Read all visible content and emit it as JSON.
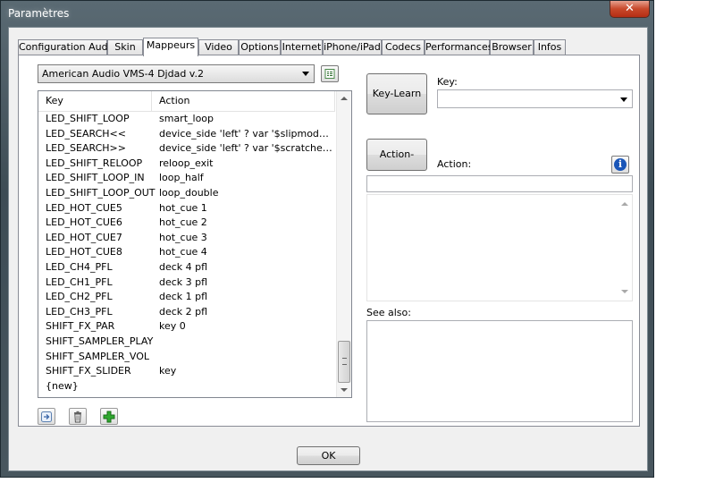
{
  "window": {
    "title": "Paramètres",
    "close_label": "✕"
  },
  "tabs": [
    {
      "label": "Configuration Audio"
    },
    {
      "label": "Skin"
    },
    {
      "label": "Mappeurs"
    },
    {
      "label": "Video"
    },
    {
      "label": "Options"
    },
    {
      "label": "Internet"
    },
    {
      "label": "iPhone/iPad"
    },
    {
      "label": "Codecs"
    },
    {
      "label": "Performances"
    },
    {
      "label": "Browser"
    },
    {
      "label": "Infos"
    }
  ],
  "mapper": {
    "selected": "American Audio VMS-4 Djdad v.2"
  },
  "table": {
    "columns": [
      "Key",
      "Action"
    ],
    "rows": [
      {
        "key": "LED_SHIFT_LOOP",
        "action": "smart_loop"
      },
      {
        "key": "LED_SEARCH<<",
        "action": "device_side 'left' ?  var '$slipmodel' ? bli..."
      },
      {
        "key": "LED_SEARCH>>",
        "action": "device_side 'left' ?  var '$scratcheffect'..."
      },
      {
        "key": "LED_SHIFT_RELOOP",
        "action": "reloop_exit"
      },
      {
        "key": "LED_SHIFT_LOOP_IN",
        "action": "loop_half"
      },
      {
        "key": "LED_SHIFT_LOOP_OUT",
        "action": "loop_double"
      },
      {
        "key": "LED_HOT_CUE5",
        "action": "hot_cue 1"
      },
      {
        "key": "LED_HOT_CUE6",
        "action": "hot_cue 2"
      },
      {
        "key": "LED_HOT_CUE7",
        "action": "hot_cue 3"
      },
      {
        "key": "LED_HOT_CUE8",
        "action": "hot_cue 4"
      },
      {
        "key": "LED_CH4_PFL",
        "action": "deck 4 pfl"
      },
      {
        "key": "LED_CH1_PFL",
        "action": "deck 3 pfl"
      },
      {
        "key": "LED_CH2_PFL",
        "action": "deck 1 pfl"
      },
      {
        "key": "LED_CH3_PFL",
        "action": "deck 2 pfl"
      },
      {
        "key": "SHIFT_FX_PAR",
        "action": "key 0"
      },
      {
        "key": "SHIFT_SAMPLER_PLAY",
        "action": ""
      },
      {
        "key": "SHIFT_SAMPLER_VOL",
        "action": ""
      },
      {
        "key": "SHIFT_FX_SLIDER",
        "action": "key"
      },
      {
        "key": "{new}",
        "action": ""
      }
    ]
  },
  "right": {
    "key_learn": "Key-Learn",
    "key_label": "Key:",
    "key_value": "",
    "action_learn": "Action-Learn",
    "action_label": "Action:",
    "action_value": "",
    "see_also_label": "See also:"
  },
  "footer": {
    "ok_label": "OK"
  },
  "icons": {
    "info": "i",
    "add": "+",
    "trash": "trash-icon",
    "export": "export-icon"
  },
  "colors": {
    "accent_blue": "#1a56b8",
    "add_green": "#2fa82f",
    "close_red": "#c7482a"
  }
}
